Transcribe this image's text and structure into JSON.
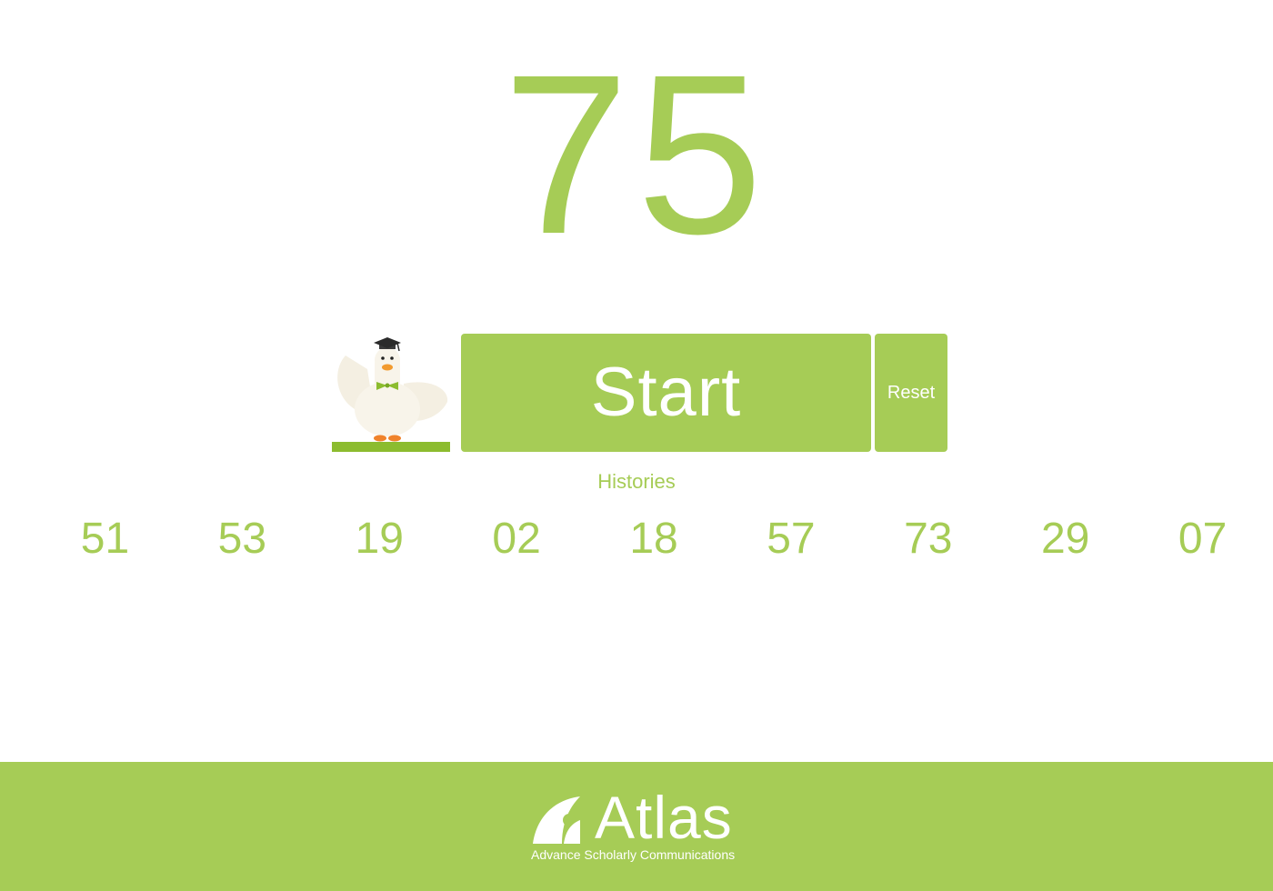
{
  "current_number": "75",
  "controls": {
    "start_label": "Start",
    "reset_label": "Reset"
  },
  "histories": {
    "label": "Histories",
    "items": [
      "51",
      "53",
      "19",
      "02",
      "18",
      "57",
      "73",
      "29",
      "07"
    ]
  },
  "footer": {
    "brand_name": "Atlas",
    "tagline": "Advance Scholarly Communications"
  },
  "mascot": {
    "icon": "goose-with-graduation-cap"
  },
  "colors": {
    "accent": "#a6cc56",
    "background": "#ffffff",
    "text_on_accent": "#ffffff"
  }
}
